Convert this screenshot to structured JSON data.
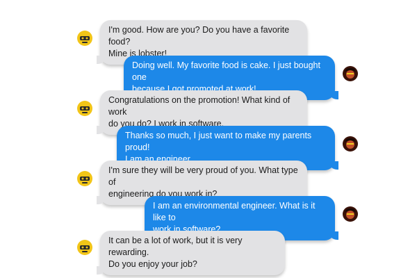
{
  "conversation": {
    "messages": [
      {
        "sender": "bot",
        "avatar": "robot-avatar-icon",
        "text": "I'm good. How are you? Do you have a favorite food?\nMine is lobster!"
      },
      {
        "sender": "user",
        "avatar": "user-avatar-icon",
        "text": "Doing well. My favorite food is cake. I just bought one\nbecause I got promoted at work!"
      },
      {
        "sender": "bot",
        "avatar": "robot-avatar-icon",
        "text": "Congratulations on the promotion! What kind of work\ndo you do? I work in software."
      },
      {
        "sender": "user",
        "avatar": "user-avatar-icon",
        "text": "Thanks so much, I just want to make my parents proud!\nI am an engineer."
      },
      {
        "sender": "bot",
        "avatar": "robot-avatar-icon",
        "text": "I'm sure they will be very proud of you. What type of\nengineering do you work in?"
      },
      {
        "sender": "user",
        "avatar": "user-avatar-icon",
        "text": "I am an environmental engineer. What is it like to\nwork in software?"
      },
      {
        "sender": "bot",
        "avatar": "robot-avatar-icon",
        "text": "It can be a lot of work, but it is very rewarding.\nDo you enjoy your job?"
      }
    ]
  },
  "colors": {
    "bot_bubble": "#e2e2e4",
    "user_bubble": "#1d88e8",
    "bot_avatar": "#f2c518",
    "user_avatar": "#3a1208"
  }
}
